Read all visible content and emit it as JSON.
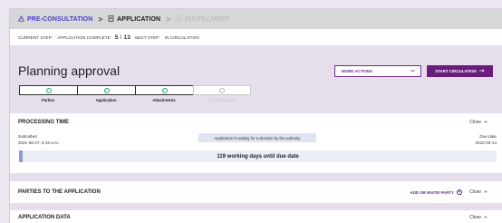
{
  "breadcrumb": {
    "steps": [
      {
        "label": "PRE-CONSULTATION",
        "icon": "warning-triangle-icon",
        "state": "done"
      },
      {
        "label": "APPLICATION",
        "icon": "document-list-icon",
        "state": "current"
      },
      {
        "label": "FULFILLMENT",
        "icon": "document-list-icon",
        "state": "disabled"
      }
    ]
  },
  "step_info": {
    "current_step_label": "CURRENT STEP:",
    "current_step_value": "APPLICATION COMPLETE",
    "count_current": "5",
    "count_sep": "/",
    "count_total": "13",
    "next_step_label": "NEXT STEP:",
    "next_step_value": "IN CIRCULATION"
  },
  "header": {
    "title": "Planning approval",
    "more_actions_label": "MORE ACTIONS",
    "start_circulation_label": "START CIRCULATION"
  },
  "tracker": [
    {
      "label": "Parties",
      "status": "complete"
    },
    {
      "label": "Application",
      "status": "complete"
    },
    {
      "label": "Attachments",
      "status": "complete"
    },
    {
      "label": "Fees & Payments",
      "status": "pending"
    }
  ],
  "processing": {
    "title": "PROCESSING TIME",
    "close_label": "Close",
    "submitted_label": "Submitted",
    "submitted_value": "2021-09-27, 9:18 a.m.",
    "status_text": "Application is waiting for a decision by the authority",
    "due_label": "Due date",
    "due_value": "2022-03-14",
    "progress_text": "119 working days until due date"
  },
  "parties": {
    "title": "PARTIES TO THE APPLICATION",
    "invite_label": "ADD OR INVITE PARTY",
    "close_label": "Close"
  },
  "application_data": {
    "title": "APPLICATION DATA",
    "close_label": "Close"
  },
  "colors": {
    "accent": "#6b1d7d",
    "active_step": "#4a3cc7",
    "success": "#2da56a",
    "progress_fill": "#8e9ad8"
  }
}
